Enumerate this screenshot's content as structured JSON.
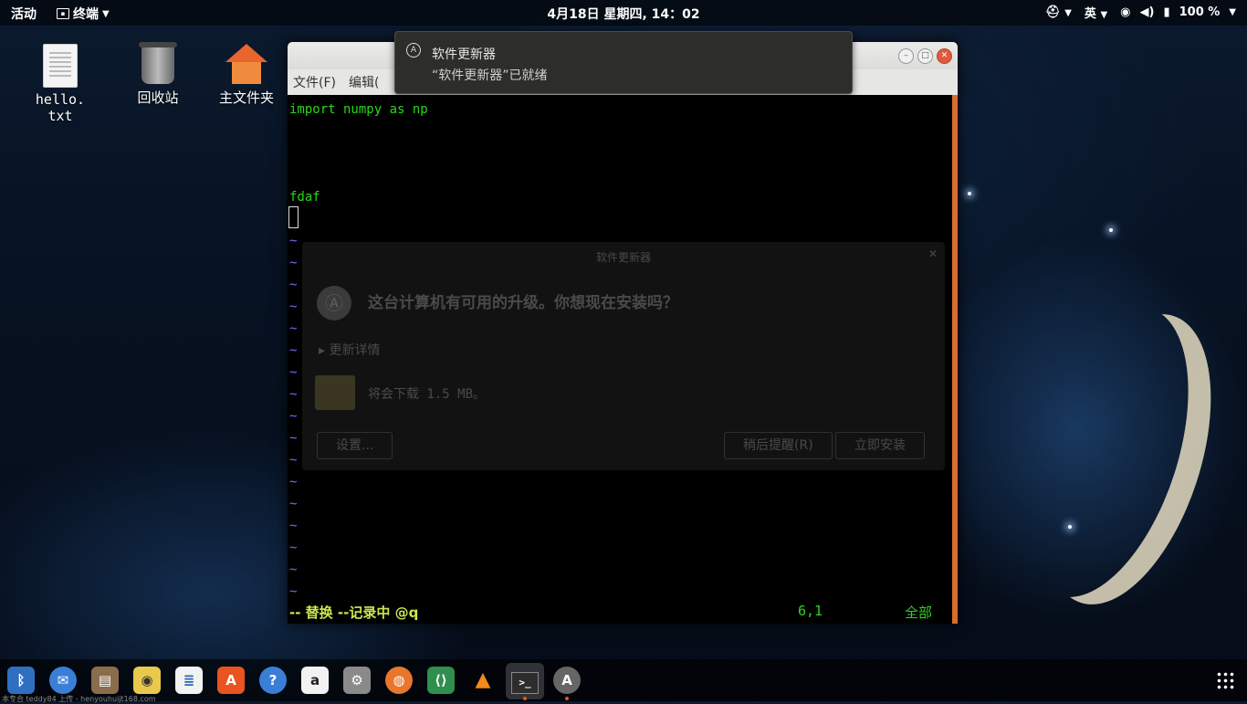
{
  "topbar": {
    "activities": "活动",
    "app_menu": "终端",
    "clock": "4月18日 星期四, 14：02",
    "input_method": "英",
    "battery": "100 %"
  },
  "desktop": {
    "icons": [
      {
        "label": "hello.\ntxt",
        "icon": "text-file-icon"
      },
      {
        "label": "回收站",
        "icon": "trash-icon"
      },
      {
        "label": "主文件夹",
        "icon": "home-folder-icon"
      }
    ]
  },
  "terminal": {
    "menu": [
      "文件(F)",
      "编辑("
    ],
    "lines": [
      "import numpy as np",
      "",
      "",
      "",
      "fdaf"
    ],
    "tilde": "~",
    "status_mode": "-- 替换 --记录中 @q",
    "status_pos": "6,1",
    "status_all": "全部"
  },
  "notification": {
    "title": "软件更新器",
    "body": "“软件更新器”已就绪"
  },
  "background_dialog": {
    "title": "软件更新器",
    "question": "这台计算机有可用的升级。你想现在安装吗？",
    "details": "▸ 更新详情",
    "size": "将会下载 1.5 MB。",
    "settings_button": "设置...",
    "remind_button": "稍后提醒(R)",
    "install_button": "立即安装"
  },
  "dock": {
    "items": [
      "bluetooth-icon",
      "thunderbird-icon",
      "file-manager-icon",
      "rhythmbox-icon",
      "libreoffice-writer-icon",
      "software-center-icon",
      "help-icon",
      "amazon-icon",
      "settings-icon",
      "firefox-icon",
      "vscode-icon",
      "vlc-icon",
      "terminal-icon",
      "software-updater-icon"
    ],
    "footer_text": "本专合 teddy84 上传 - henyouhuijt168.com"
  },
  "colors": {
    "terminal_text": "#2bd61c",
    "status_text": "#c9e84e",
    "tilde": "#7a69ff",
    "scrollbar": "#d96d2f",
    "close_button": "#e05a3a"
  }
}
